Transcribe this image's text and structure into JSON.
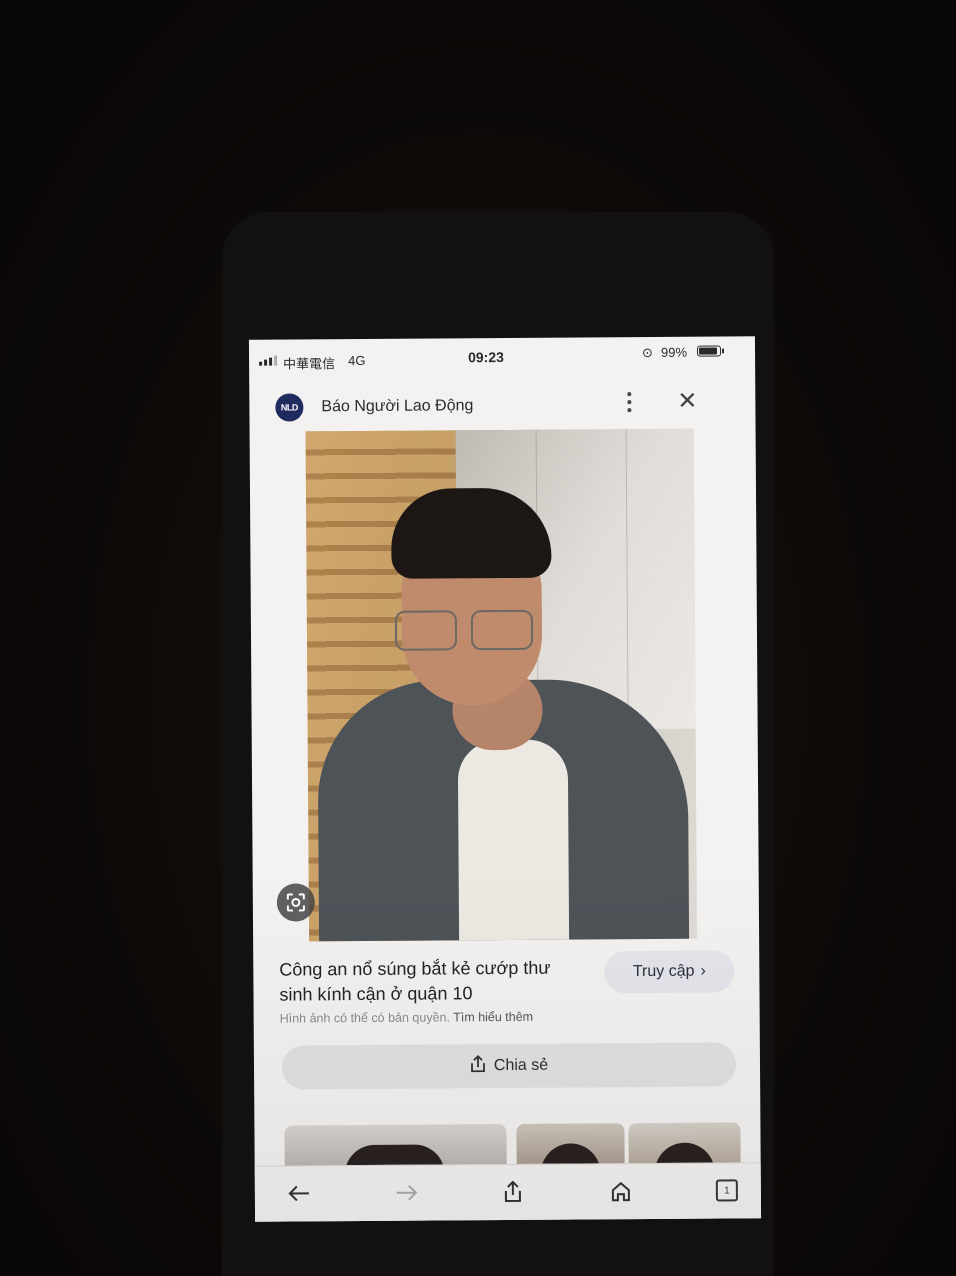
{
  "status_bar": {
    "carrier": "中華電信",
    "network": "4G",
    "time": "09:23",
    "battery": "99%"
  },
  "header": {
    "logo_text": "NLD",
    "site_name": "Báo Người Lao Động"
  },
  "result": {
    "title": "Công an nổ súng bắt kẻ cướp thư sinh kính cận ở quận 10",
    "visit_label": "Truy cập",
    "copyright_note": "Hình ảnh có thể có bản quyền.",
    "learn_more": "Tìm hiểu thêm",
    "share_label": "Chia sẻ"
  },
  "toolbar": {
    "tab_count": "1"
  },
  "colors": {
    "logo_bg": "#1f2b5e",
    "button_bg": "#e3e5ea",
    "share_bg": "#e2e1e2"
  }
}
